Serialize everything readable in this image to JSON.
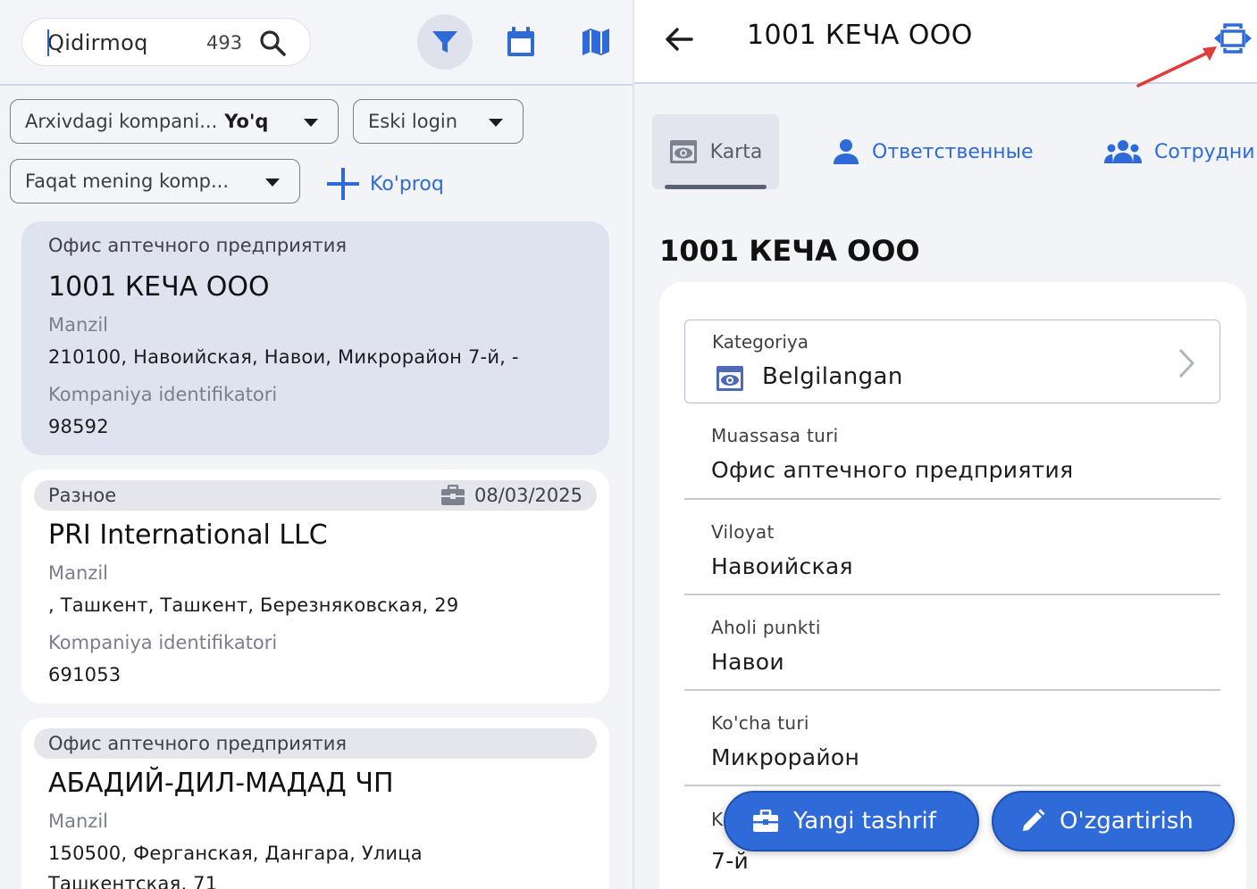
{
  "search": {
    "value": "Qidirmoq",
    "count": "493"
  },
  "filters": {
    "archived": {
      "label": "Arxivdagi kompani...",
      "value": "Yo'q"
    },
    "old_login": {
      "label": "Eski login"
    },
    "mine": {
      "label": "Faqat mening komp..."
    },
    "more_label": "Ko'proq"
  },
  "list": [
    {
      "tag": "Офис аптечного предприятия",
      "date": "",
      "title": "1001 КЕЧА ООО",
      "address_label": "Manzil",
      "address": "210100, Навоийская, Навои, Микрорайон 7-й, -",
      "id_label": "Kompaniya identifikatori",
      "id": "98592"
    },
    {
      "tag": "Разное",
      "date": "08/03/2025",
      "title": "PRI International LLC",
      "address_label": "Manzil",
      "address": ", Ташкент, Ташкент,  Березняковская, 29",
      "id_label": "Kompaniya identifikatori",
      "id": "691053"
    },
    {
      "tag": "Офис аптечного предприятия",
      "date": "",
      "title": "АБАДИЙ-ДИЛ-МАДАД ЧП",
      "address_label": "Manzil",
      "address": "150500, Ферганская, Дангара, Улица",
      "address2": "Ташкентская, 71"
    }
  ],
  "detail": {
    "header_title": "1001 КЕЧА ООО",
    "tabs": [
      "Karta",
      "Ответственные",
      "Сотрудни"
    ],
    "company_title": "1001 КЕЧА ООО",
    "category": {
      "label": "Kategoriya",
      "value": "Belgilangan"
    },
    "fields": [
      {
        "label": "Muassasa turi",
        "value": "Офис аптечного предприятия"
      },
      {
        "label": "Viloyat",
        "value": "Навоийская"
      },
      {
        "label": "Aholi punkti",
        "value": "Навои"
      },
      {
        "label": "Ko'cha turi",
        "value": "Микрорайон"
      },
      {
        "label": "K",
        "value": "7-й"
      }
    ],
    "actions": {
      "new_visit": "Yangi tashrif",
      "edit": "O'zgartirish"
    }
  },
  "colors": {
    "accent": "#2f6ad9",
    "selected_card": "#dfe3f0",
    "background": "#f3f4f8"
  },
  "icons": [
    "search-icon",
    "filter-icon",
    "calendar-icon",
    "map-icon",
    "plus-icon",
    "briefcase-icon",
    "back-arrow-icon",
    "expand-icon",
    "eye-card-icon",
    "person-icon",
    "people-icon",
    "chevron-right-icon",
    "pencil-icon"
  ]
}
